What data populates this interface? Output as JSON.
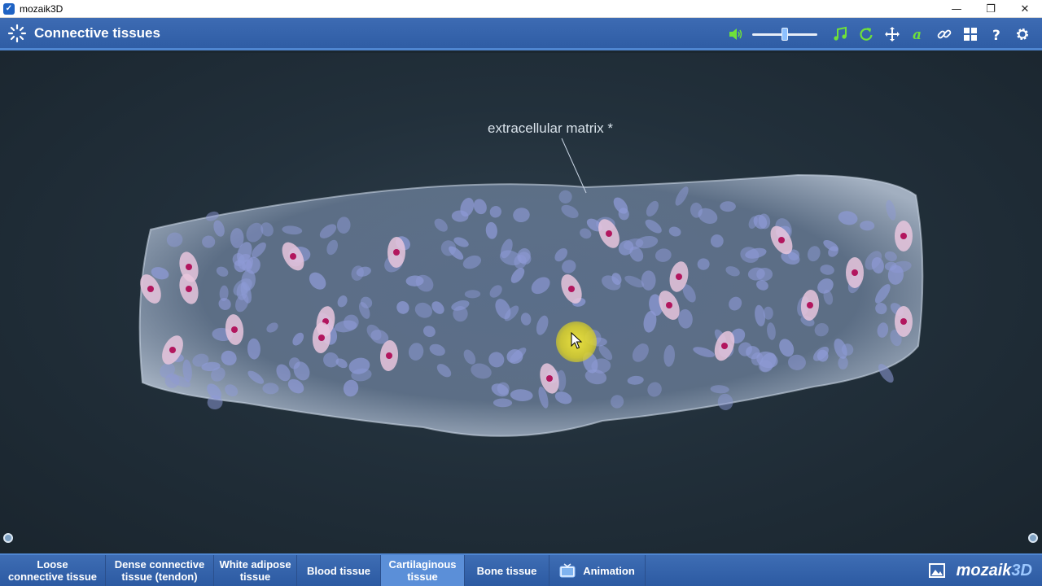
{
  "window": {
    "app_name": "mozaik3D",
    "controls": {
      "minimize": "—",
      "restore": "❐",
      "close": "✕"
    }
  },
  "header": {
    "title": "Connective tissues",
    "volume_level": 0.5,
    "icons": [
      "volume-icon",
      "music-icon",
      "reset-icon",
      "move-icon",
      "font-icon",
      "link-icon",
      "menu-grid-icon",
      "help-icon",
      "settings-icon"
    ],
    "accent_color": "#2f5da5",
    "icon_green": "#6fe13a"
  },
  "scene": {
    "annotation": "extracellular matrix *"
  },
  "tabs": [
    {
      "label": "Loose connective tissue",
      "line1": "Loose",
      "line2": "connective tissue",
      "active": false
    },
    {
      "label": "Dense connective tissue (tendon)",
      "line1": "Dense connective",
      "line2": "tissue (tendon)",
      "active": false
    },
    {
      "label": "White adipose tissue",
      "line1": "White adipose",
      "line2": "tissue",
      "active": false
    },
    {
      "label": "Blood tissue",
      "line1": "Blood tissue",
      "line2": "",
      "active": false
    },
    {
      "label": "Cartilaginous tissue",
      "line1": "Cartilaginous",
      "line2": "tissue",
      "active": true
    },
    {
      "label": "Bone tissue",
      "line1": "Bone tissue",
      "line2": "",
      "active": false
    },
    {
      "label": "Animation",
      "line1": "Animation",
      "line2": "",
      "active": false
    }
  ],
  "brand": {
    "prefix": "mozaik",
    "suffix": "3D"
  }
}
